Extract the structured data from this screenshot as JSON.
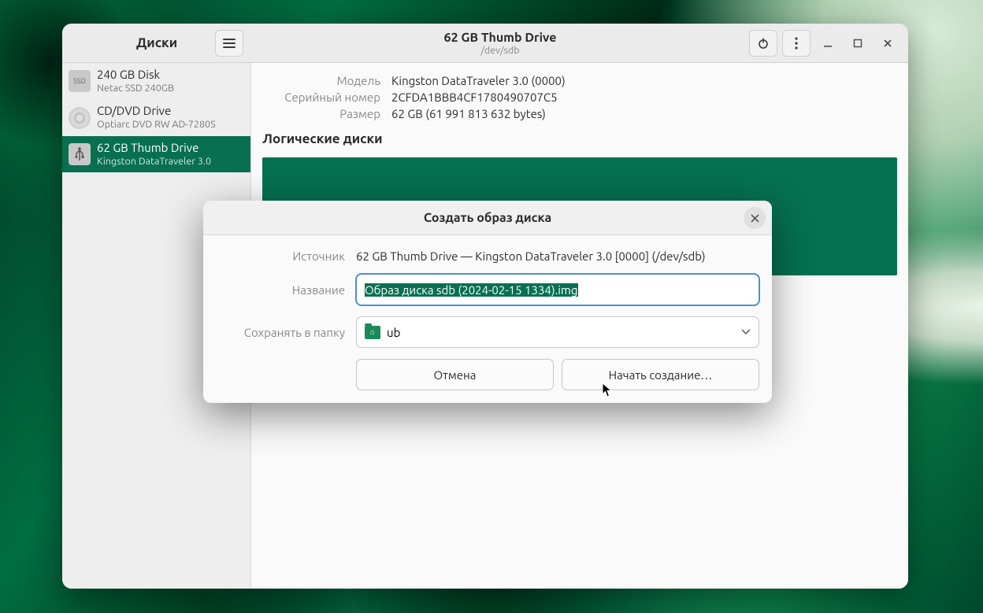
{
  "titlebar": {
    "left_title": "Диски",
    "center_title": "62 GB Thumb Drive",
    "center_subtitle": "/dev/sdb"
  },
  "sidebar": {
    "devices": [
      {
        "title": "240 GB Disk",
        "sub": "Netac SSD 240GB",
        "icon": "ssd"
      },
      {
        "title": "CD/DVD Drive",
        "sub": "Optiarc DVD RW AD-7280S",
        "icon": "disc"
      },
      {
        "title": "62 GB Thumb Drive",
        "sub": "Kingston DataTraveler 3.0",
        "icon": "usb",
        "selected": true
      }
    ]
  },
  "details": {
    "rows": [
      {
        "label": "Модель",
        "value": "Kingston DataTraveler 3.0 (0000)"
      },
      {
        "label": "Серийный номер",
        "value": "2CFDA1BBB4CF1780490707C5"
      },
      {
        "label": "Размер",
        "value": "62 GB (61 991 813 632 bytes)"
      }
    ],
    "section_title": "Логические диски"
  },
  "dialog": {
    "title": "Создать образ диска",
    "source_label": "Источник",
    "source_value": "62 GB Thumb Drive — Kingston DataTraveler 3.0 [0000] (/dev/sdb)",
    "name_label": "Название",
    "name_value": "Образ диска sdb (2024-02-15 1334).img",
    "folder_label": "Сохранять в папку",
    "folder_value": "ub",
    "cancel": "Отмена",
    "start": "Начать создание…"
  }
}
